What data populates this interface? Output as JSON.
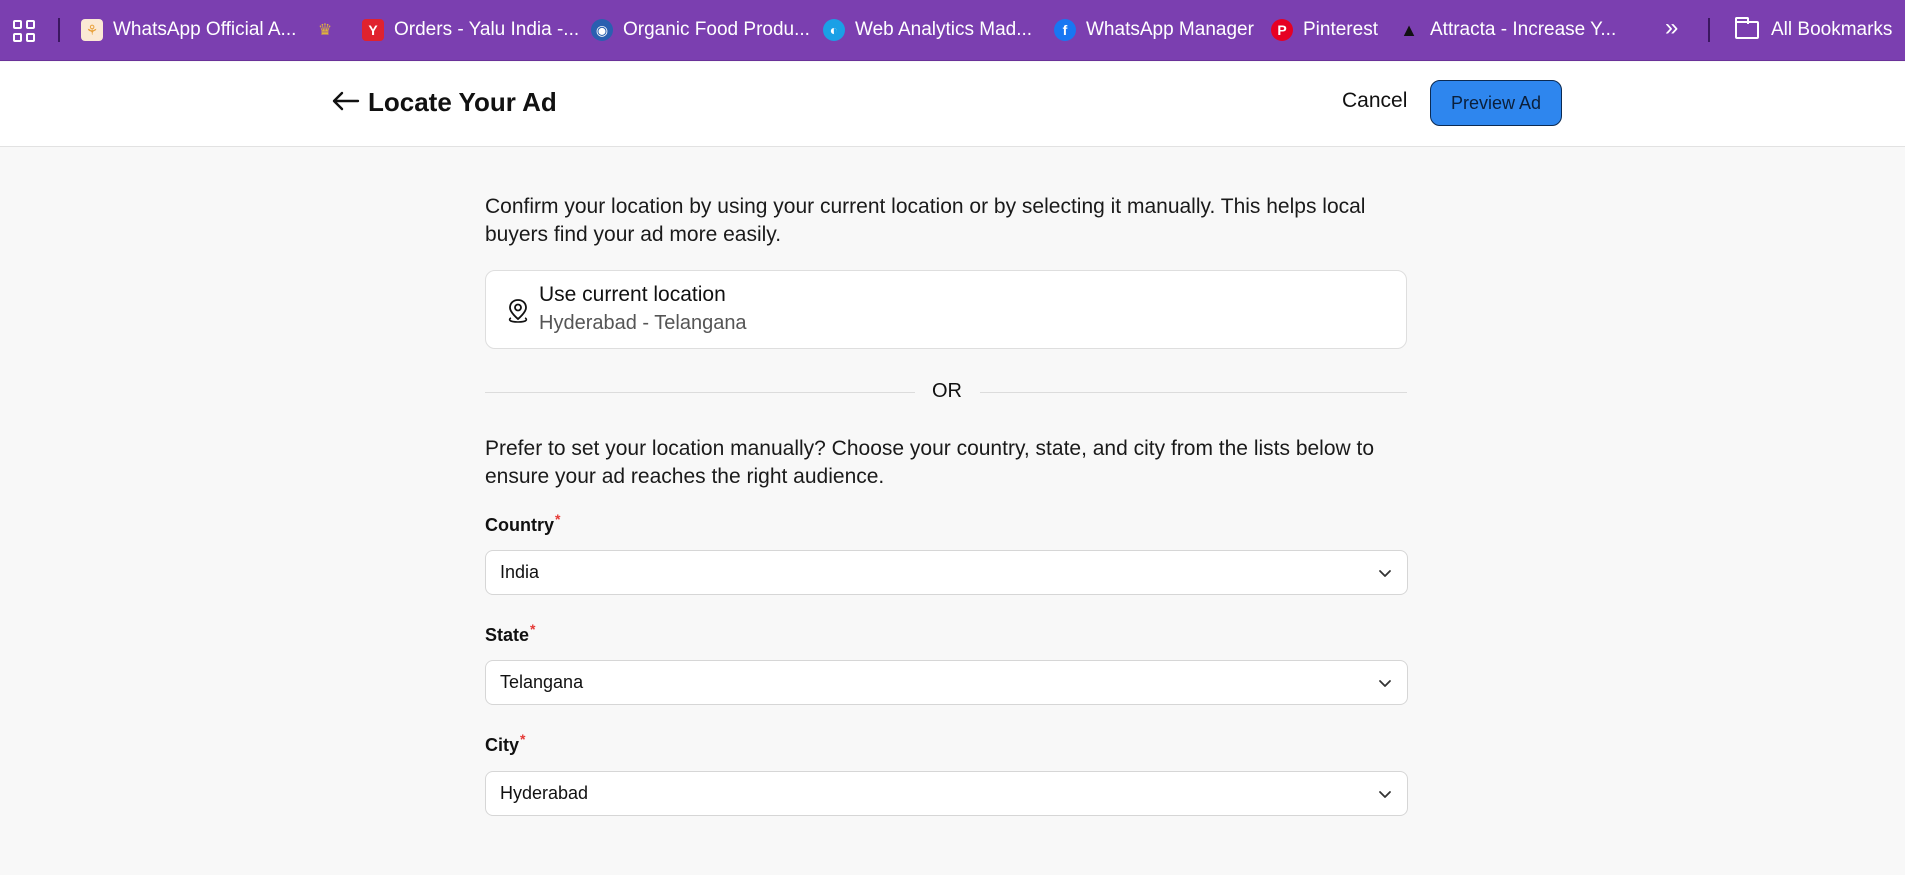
{
  "bookmarks_bar": {
    "items": [
      {
        "label": "WhatsApp Official A...",
        "icon": "whatsapp-official-favicon",
        "color": "#e8a03a"
      },
      {
        "label": "",
        "icon": "yalu-logo-favicon",
        "color": "#c9a227"
      },
      {
        "label": "Orders - Yalu India -...",
        "icon": "yalu-y-favicon",
        "color": "#e0222e"
      },
      {
        "label": "Organic Food Produ...",
        "icon": "globe-favicon",
        "color": "#2a5fb0"
      },
      {
        "label": "Web Analytics Mad...",
        "icon": "analytics-favicon",
        "color": "#1aa0e6"
      },
      {
        "label": "WhatsApp Manager",
        "icon": "facebook-favicon",
        "color": "#1877f2"
      },
      {
        "label": "Pinterest",
        "icon": "pinterest-favicon",
        "color": "#e60023"
      },
      {
        "label": "Attracta - Increase Y...",
        "icon": "attracta-favicon",
        "color": "#111111"
      }
    ],
    "overflow_glyph": "»",
    "all_bookmarks_label": "All Bookmarks"
  },
  "header": {
    "title": "Locate Your Ad",
    "cancel_label": "Cancel",
    "preview_label": "Preview Ad",
    "accent_color": "#2e86ee"
  },
  "main": {
    "intro_text": "Confirm your location by using your current location or by selecting it manually. This helps local buyers find your ad more easily.",
    "current_location": {
      "title": "Use current location",
      "value": "Hyderabad - Telangana"
    },
    "or_label": "OR",
    "manual_text": "Prefer to set your location manually? Choose your country, state, and city from the lists below to ensure your ad reaches the right audience.",
    "fields": {
      "country": {
        "label": "Country",
        "required_mark": "*",
        "value": "India"
      },
      "state": {
        "label": "State",
        "required_mark": "*",
        "value": "Telangana"
      },
      "city": {
        "label": "City",
        "required_mark": "*",
        "value": "Hyderabad"
      }
    }
  }
}
